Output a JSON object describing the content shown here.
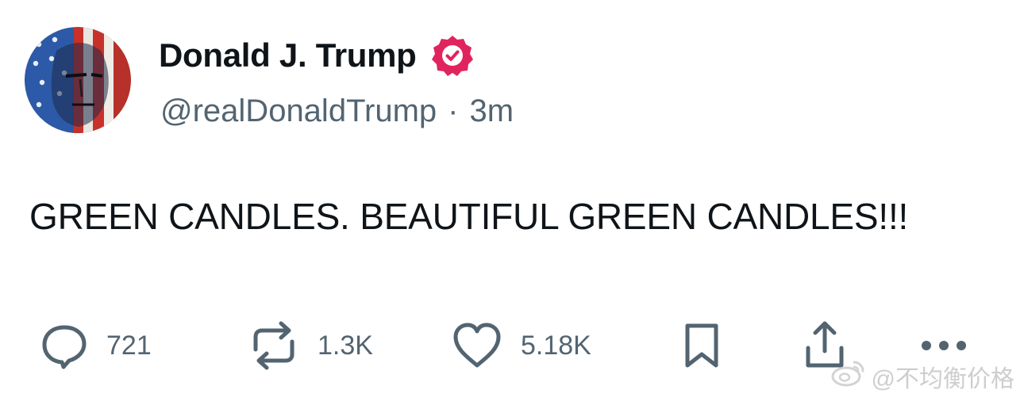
{
  "author": {
    "display_name": "Donald J. Trump",
    "handle": "@realDonaldTrump",
    "separator": "·",
    "time": "3m",
    "verified": true
  },
  "post": {
    "text": "GREEN CANDLES. BEAUTIFUL GREEN CANDLES!!!"
  },
  "actions": {
    "replies": "721",
    "reposts": "1.3K",
    "likes": "5.18K"
  },
  "watermark": {
    "text": "@不均衡价格"
  },
  "colors": {
    "text_primary": "#0f1419",
    "text_secondary": "#536471",
    "verified_badge": "#e0245e"
  },
  "icons": {
    "reply": "speech-bubble-icon",
    "repost": "repost-arrows-icon",
    "like": "heart-icon",
    "bookmark": "bookmark-icon",
    "share": "share-icon",
    "more": "ellipsis-icon"
  }
}
